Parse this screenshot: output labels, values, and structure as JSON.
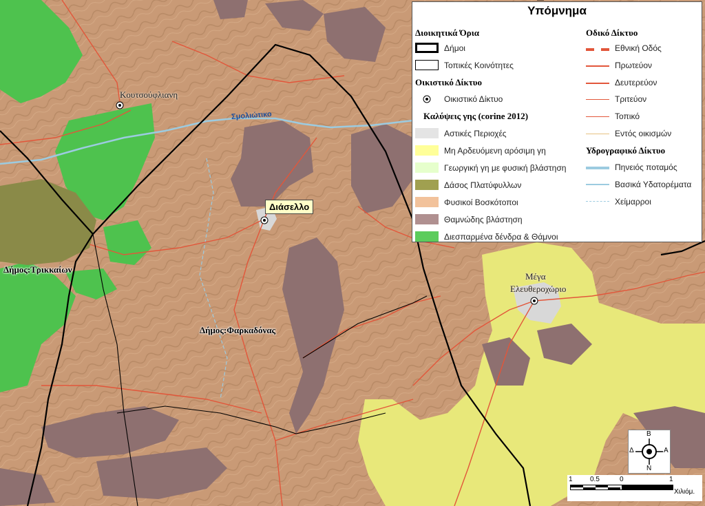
{
  "legend": {
    "title": "Υπόμνημα",
    "admin_header": "Διοικητικά Όρια",
    "admin_items": [
      "Δήμοι",
      "Τοπικές Κοινότητες"
    ],
    "settlement_header": "Οικιστικό Δίκτυο",
    "settlement_item": "Οικιστικό Δίκτυο",
    "landcover_header": "Καλύψεις γης (corine 2012)",
    "landcover_items": [
      {
        "label": "Αστικές Περιοχές",
        "color": "#e4e4e4"
      },
      {
        "label": "Μη Αρδευόμενη αρόσιμη γη",
        "color": "#ffff99"
      },
      {
        "label": "Γεωργική γη με φυσική βλάστηση",
        "color": "#e6ffcc"
      },
      {
        "label": "Δάσος Πλατύφυλλων",
        "color": "#a0a050"
      },
      {
        "label": "Φυσικοί Βοσκότοποι",
        "color": "#f2c29b"
      },
      {
        "label": "Θαμνώδης βλάστηση",
        "color": "#b09090"
      },
      {
        "label": "Διεσπαρμένα δένδρα & Θάμνοι",
        "color": "#5ccc5c"
      }
    ],
    "road_header": "Οδικό Δίκτυο",
    "road_items": [
      "Εθνική Οδός",
      "Πρωτεύον",
      "Δευτερεύον",
      "Τριτεύον",
      "Τοπικό",
      "Εντός οικισμών"
    ],
    "hydro_header": "Υδρογραφικό Δίκτυο",
    "hydro_items": [
      "Πηνειός ποταμός",
      "Βασικά Υδατορέματα",
      "Χείμαρροι"
    ]
  },
  "map_labels": {
    "koutsouflianh": "Κουτσούφλιανη",
    "smoliotiko": "Σμολιώτικο",
    "diasello": "Διάσελλο",
    "dimos_trikkaion": "Δήμος:Τρικκαίων",
    "dimos_farkadonas": "Δήμος:Φαρκαδόνας",
    "mega_line1": "Μέγα",
    "mega_line2": "Ελευθεροχώριο"
  },
  "compass": {
    "n_top": "Β",
    "s_bottom": "Ν",
    "w_left": "Δ",
    "e_right": "Α"
  },
  "scale": {
    "ticks": [
      "1",
      "0.5",
      "0",
      "1"
    ],
    "unit": "Χιλιόμ."
  },
  "colors": {
    "terrain": "#c99a76",
    "shrub": "#8e7070",
    "forest_sparse": "#4ec24e",
    "broadleaf": "#8a8a48",
    "arable": "#e8e87a",
    "urban": "#d4d4d4",
    "road": "#e2563a",
    "boundary": "#000000",
    "river": "#9ccbe0"
  }
}
